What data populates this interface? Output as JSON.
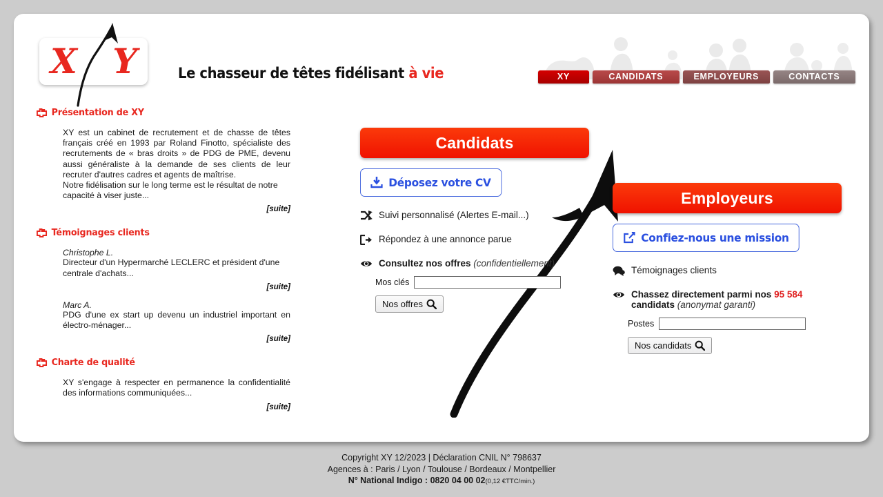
{
  "header": {
    "logo_x": "X",
    "logo_y": "Y",
    "slogan_main": "Le chasseur de têtes fidélisant ",
    "slogan_accent": "à vie",
    "nav": [
      {
        "label": "XY",
        "color": "#c40000"
      },
      {
        "label": "CANDIDATS",
        "color": "#a83c3c"
      },
      {
        "label": "EMPLOYEURS",
        "color": "#8a4a4a"
      },
      {
        "label": "CONTACTS",
        "color": "#8a7878"
      }
    ]
  },
  "left": {
    "presentation": {
      "heading": "Présentation de XY",
      "body": "XY est un cabinet de recrutement et de chasse de têtes français créé en 1993 par Roland Finotto, spécialiste des recrutements de « bras droits » de PDG de PME, devenu aussi généraliste à la demande de ses clients de leur recruter d'autres cadres et agents de maîtrise.",
      "body2": "Notre fidélisation sur le long terme est le résultat de notre capacité à viser juste...",
      "more": "[suite]"
    },
    "testimonials": {
      "heading": "Témoignages clients",
      "items": [
        {
          "name": "Christophe L.",
          "text": "Directeur d'un Hypermarché LECLERC et président d'une centrale d'achats...",
          "more": "[suite]"
        },
        {
          "name": "Marc A.",
          "text": "PDG d'une ex start up devenu un industriel important en électro-ménager...",
          "more": "[suite]"
        }
      ]
    },
    "charter": {
      "heading": "Charte de qualité",
      "body": "XY s'engage à respecter en permanence la confidentialité des informations communiquées...",
      "more": "[suite]"
    }
  },
  "candidates": {
    "title": "Candidats",
    "upload_cv": "Déposez votre CV",
    "follow": "Suivi personnalisé (Alertes E-mail...)",
    "reply": "Répondez à une annonce parue",
    "offers_label": "Consultez nos offres",
    "offers_note": "(confidentiellement)",
    "keywords_label": "Mos clés",
    "keywords_value": "",
    "keywords_placeholder": "",
    "search_button": "Nos offres"
  },
  "employers": {
    "title": "Employeurs",
    "mission": "Confiez-nous une mission",
    "testimonials": "Témoignages clients",
    "hunt_prefix": "Chassez directement parmi nos ",
    "hunt_count": "95 584",
    "hunt_suffix": " candidats",
    "hunt_note": "(anonymat garanti)",
    "posts_label": "Postes",
    "posts_value": "",
    "posts_placeholder": "",
    "search_button": "Nos candidats"
  },
  "footer": {
    "line1": "Copyright XY 12/2023  |  Déclaration CNIL N° 798637",
    "line2": "Agences à : Paris / Lyon / Toulouse / Bordeaux / Montpellier",
    "line3_label": "N° National Indigo : 0820 04 00 02",
    "line3_note": "(0,12 €TTC/min.)"
  }
}
